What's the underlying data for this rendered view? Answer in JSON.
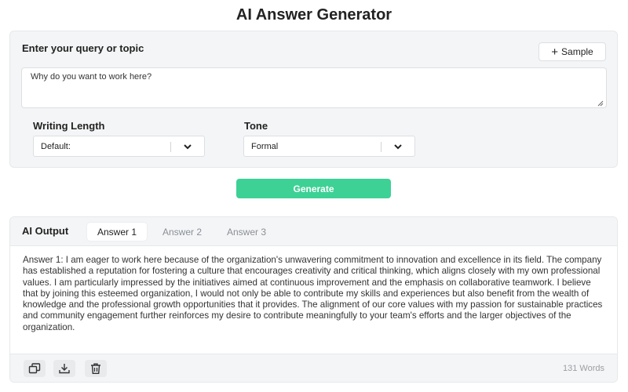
{
  "app": {
    "title": "AI Answer Generator"
  },
  "query": {
    "label": "Enter your query or topic",
    "value": "Why do you want to work here?",
    "sample_label": "Sample"
  },
  "length": {
    "label": "Writing Length",
    "value": "Default:"
  },
  "tone": {
    "label": "Tone",
    "value": "Formal"
  },
  "generate_label": "Generate",
  "output": {
    "label": "AI Output",
    "tabs": [
      "Answer 1",
      "Answer 2",
      "Answer 3"
    ],
    "active_tab": 0,
    "text": "Answer 1: I am eager to work here because of the organization's unwavering commitment to innovation and excellence in its field. The company has established a reputation for fostering a culture that encourages creativity and critical thinking, which aligns closely with my own professional values. I am particularly impressed by the initiatives aimed at continuous improvement and the emphasis on collaborative teamwork. I believe that by joining this esteemed organization, I would not only be able to contribute my skills and experiences but also benefit from the wealth of knowledge and the professional growth opportunities that it provides. The alignment of our core values with my passion for sustainable practices and community engagement further reinforces my desire to contribute meaningfully to your team's efforts and the larger objectives of the organization.",
    "word_count": "131 Words"
  },
  "colors": {
    "accent": "#3dd195",
    "panel": "#f4f5f6",
    "border": "#e6e8ea"
  },
  "icons": {
    "sample": "plus-icon",
    "copy": "copy-icon",
    "download": "download-icon",
    "delete": "trash-icon",
    "dropdown": "chevron-down-icon"
  }
}
